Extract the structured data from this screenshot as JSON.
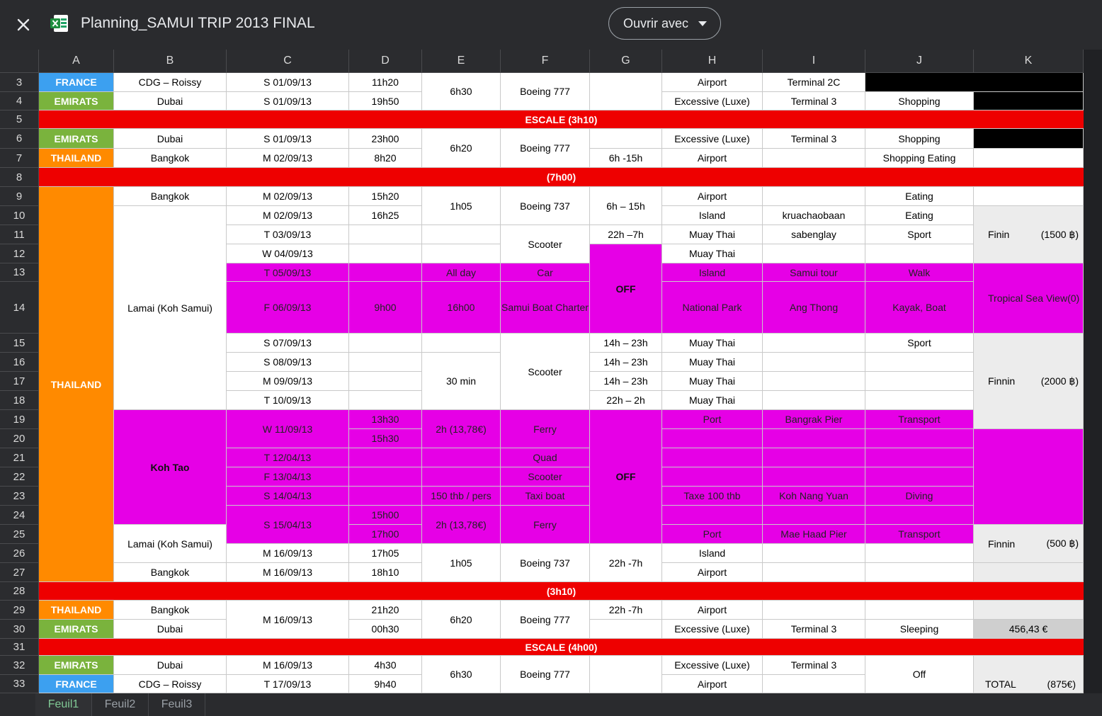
{
  "toolbar": {
    "close_icon": "close-icon",
    "file_icon": "excel-file-icon",
    "title": "Planning_SAMUI TRIP 2013 FINAL",
    "open_with_label": "Ouvrir avec",
    "open_with_icon": "caret-down-icon"
  },
  "columns": [
    "A",
    "B",
    "C",
    "D",
    "E",
    "F",
    "G",
    "H",
    "I",
    "J",
    "K"
  ],
  "rows": [
    "3",
    "4",
    "5",
    "6",
    "7",
    "8",
    "9",
    "10",
    "11",
    "12",
    "13",
    "14",
    "15",
    "16",
    "17",
    "18",
    "19",
    "20",
    "21",
    "22",
    "23",
    "24",
    "25",
    "26",
    "27",
    "28",
    "29",
    "30",
    "31",
    "32",
    "33"
  ],
  "cells": {
    "a3": "FRANCE",
    "b3": "CDG – Roissy",
    "c3": "S  01/09/13",
    "d3": "11h20",
    "e34": "6h30",
    "f34": "Boeing 777",
    "h3": "Airport",
    "i3": "Terminal 2C",
    "a4": "EMIRATS",
    "b4": "Dubai",
    "c4": "S  01/09/13",
    "d4": "19h50",
    "h4": "Excessive (Luxe)",
    "i4": "Terminal 3",
    "j4": "Shopping",
    "r5": "ESCALE (3h10)",
    "a6": "EMIRATS",
    "b6": "Dubai",
    "c6": "S  01/09/13",
    "d6": "23h00",
    "e67": "6h20",
    "f67": "Boeing 777",
    "h6": "Excessive (Luxe)",
    "i6": "Terminal 3",
    "j6": "Shopping",
    "a7": "THAILAND",
    "b7": "Bangkok",
    "c7": "M  02/09/13",
    "d7": "8h20",
    "g7": "6h -15h",
    "h7": "Airport",
    "j7": "Shopping Eating",
    "r8": "(7h00)",
    "a9": "THAILAND",
    "b9": "Bangkok",
    "c9": "M  02/09/13",
    "d9": "15h20",
    "e910": "1h05",
    "f910": "Boeing 737",
    "g910": "6h – 15h",
    "h9": "Airport",
    "j9": "Eating",
    "b10": "Lamai (Koh Samui)",
    "c10": "M  02/09/13",
    "d10": "16h25",
    "h10": "Island",
    "i10": "kruachaobaan",
    "j10": "Eating",
    "k1012a": "Finin",
    "k1012b": "(1500 ฿)",
    "c11": "T  03/09/13",
    "f1112": "Scooter",
    "g11": "22h –7h",
    "h11": "Muay Thai",
    "i11": "sabenglay",
    "j11": "Sport",
    "c12": "W  04/09/13",
    "h12": "Muay Thai",
    "g1214": "OFF",
    "c13": "T  05/09/13",
    "e13": "All day",
    "f13": "Car",
    "h13": "Island",
    "i13": "Samui tour",
    "j13": "Walk",
    "k1314a": "Tropical Sea View",
    "k1314b": "(0)",
    "c14": "F  06/09/13",
    "d14": "9h00",
    "e14": "16h00",
    "f14": "Samui Boat Charter",
    "h14": "National Park",
    "i14": "Ang Thong",
    "j14": "Kayak, Boat",
    "c15": "S  07/09/13",
    "g15": "14h – 23h",
    "h15": "Muay Thai",
    "j15": "Sport",
    "c16": "S  08/09/13",
    "g16": "14h – 23h",
    "h16": "Muay Thai",
    "c17": "M  09/09/13",
    "g17": "14h – 23h",
    "h17": "Muay Thai",
    "c18": "T  10/09/13",
    "g18": "22h – 2h",
    "h18": "Muay Thai",
    "e1518": "30 min",
    "f1518": "Scooter",
    "k1519a": "Finnin",
    "k1519b": "(2000 ฿)",
    "b1925": "Koh Tao",
    "c1920": "W  11/09/13",
    "d19": "13h30",
    "d20": "15h30",
    "e1920": "2h (13,78€)",
    "f1920": "Ferry",
    "g1925": "OFF",
    "h19": "Port",
    "i19": "Bangrak Pier",
    "j19": "Transport",
    "c21": "T  12/04/13",
    "f21": "Quad",
    "c22": "F  13/04/13",
    "f22": "Scooter",
    "c23": "S  14/04/13",
    "e23": "150 thb / pers",
    "f23": "Taxi boat",
    "h23": "Taxe 100 thb",
    "i23": "Koh Nang Yuan",
    "j23": "Diving",
    "c2425": "S  15/04/13",
    "d24": "15h00",
    "d25": "17h00",
    "e2425": "2h (13,78€)",
    "f2425": "Ferry",
    "h25": "Port",
    "i25": "Mae Haad Pier",
    "j25": "Transport",
    "b2526": "Lamai (Koh Samui)",
    "k2526a": "Finnin",
    "k2526b": "(500 ฿)",
    "c26": "M  16/09/13",
    "d26": "17h05",
    "e2627": "1h05",
    "f2627": "Boeing 737",
    "g2627": "22h -7h",
    "h26": "Island",
    "b27": "Bangkok",
    "c27": "M  16/09/13",
    "d27": "18h10",
    "h27": "Airport",
    "r28": "(3h10)",
    "a29": "THAILAND",
    "b29": "Bangkok",
    "c2930": "M  16/09/13",
    "d29": "21h20",
    "e2930": "6h20",
    "f2930": "Boeing 777",
    "g29": "22h -7h",
    "h29": "Airport",
    "a30": "EMIRATS",
    "b30": "Dubai",
    "d30": "00h30",
    "h30": "Excessive (Luxe)",
    "i30": "Terminal 3",
    "j30": "Sleeping",
    "k30": "456,43 €",
    "r31": "ESCALE (4h00)",
    "a32": "EMIRATS",
    "b32": "Dubai",
    "c32": "M  16/09/13",
    "d32": "4h30",
    "e3233": "6h30",
    "f3233": "Boeing 777",
    "h32": "Excessive (Luxe)",
    "i32": "Terminal 3",
    "j3233": "Off",
    "a33": "FRANCE",
    "b33": "CDG – Roissy",
    "c33": "T  17/09/13",
    "d33": "9h40",
    "h33": "Airport",
    "k3233a": "TOTAL",
    "k3233b": "(875€)"
  },
  "sheet_tabs": [
    "Feuil1",
    "Feuil2",
    "Feuil3"
  ],
  "colors": {
    "france": "#3ca0f0",
    "emirats": "#7ab33d",
    "thailand": "#ff8a00",
    "escale": "#ee0000",
    "activity": "#e600e6"
  }
}
